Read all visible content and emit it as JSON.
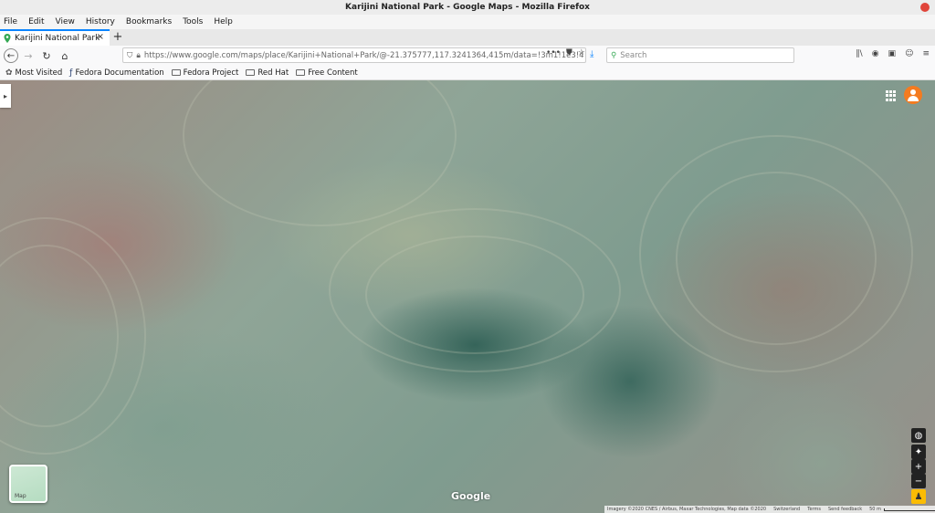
{
  "window": {
    "title": "Karijini National Park - Google Maps - Mozilla Firefox"
  },
  "menu": [
    "File",
    "Edit",
    "View",
    "History",
    "Bookmarks",
    "Tools",
    "Help"
  ],
  "tab": {
    "label": "Karijini National Park",
    "close": "×",
    "new_tab": "+"
  },
  "url": {
    "value": "https://www.google.com/maps/place/Karijini+National+Park/@-21.375777,117.3241364,415m/data=!3m1!1e3!4"
  },
  "search": {
    "placeholder": "Search"
  },
  "bookmarks": [
    {
      "label": "Most Visited",
      "icon": "gear-icon"
    },
    {
      "label": "Fedora Documentation",
      "icon": "fedora-icon"
    },
    {
      "label": "Fedora Project",
      "icon": "folder-icon"
    },
    {
      "label": "Red Hat",
      "icon": "folder-icon"
    },
    {
      "label": "Free Content",
      "icon": "folder-icon"
    }
  ],
  "map": {
    "type_button": "Map",
    "logo": "Google",
    "attribution": "Imagery ©2020 CNES / Airbus, Maxar Technologies, Map data ©2020",
    "country": "Switzerland",
    "terms": "Terms",
    "feedback": "Send feedback",
    "scale": "50 m"
  },
  "colors": {
    "accent": "#0a84ff",
    "avatar": "#f47b20",
    "pegman": "#fbbc04",
    "close": "#e0443a"
  }
}
